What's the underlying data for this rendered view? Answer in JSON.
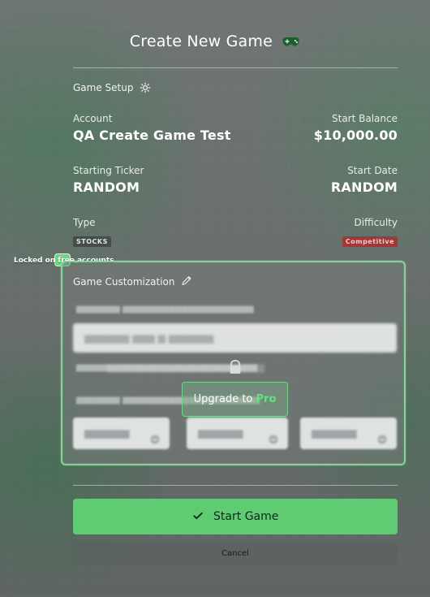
{
  "modal": {
    "title": "Create New Game"
  },
  "setup": {
    "section_label": "Game Setup",
    "account_label": "Account",
    "account_value": "QA Create Game Test",
    "start_balance_label": "Start Balance",
    "start_balance_value": "$10,000.00",
    "starting_ticker_label": "Starting Ticker",
    "starting_ticker_value": "RANDOM",
    "start_date_label": "Start Date",
    "start_date_value": "RANDOM",
    "type_label": "Type",
    "type_badge": "STOCKS",
    "difficulty_label": "Difficulty",
    "difficulty_badge": "Competitive"
  },
  "customization": {
    "locked_note": "Locked on free accounts",
    "section_label": "Game Customization",
    "upgrade_prefix": "Upgrade to ",
    "upgrade_highlight": "Pro"
  },
  "actions": {
    "start_label": "Start Game",
    "cancel_label": "Cancel"
  },
  "icons": {
    "title": "controller-icon",
    "setup": "gear-icon",
    "customization": "pencil-icon",
    "lock": "lock-icon",
    "start": "check-icon",
    "select": "chevron-down-icon"
  },
  "colors": {
    "accent": "#5fcb73",
    "accent_border": "#7ad98e",
    "upgrade_text": "#67df83",
    "difficulty_badge_bg": "#ae2a2a",
    "type_badge_bg": "#3c4240"
  }
}
